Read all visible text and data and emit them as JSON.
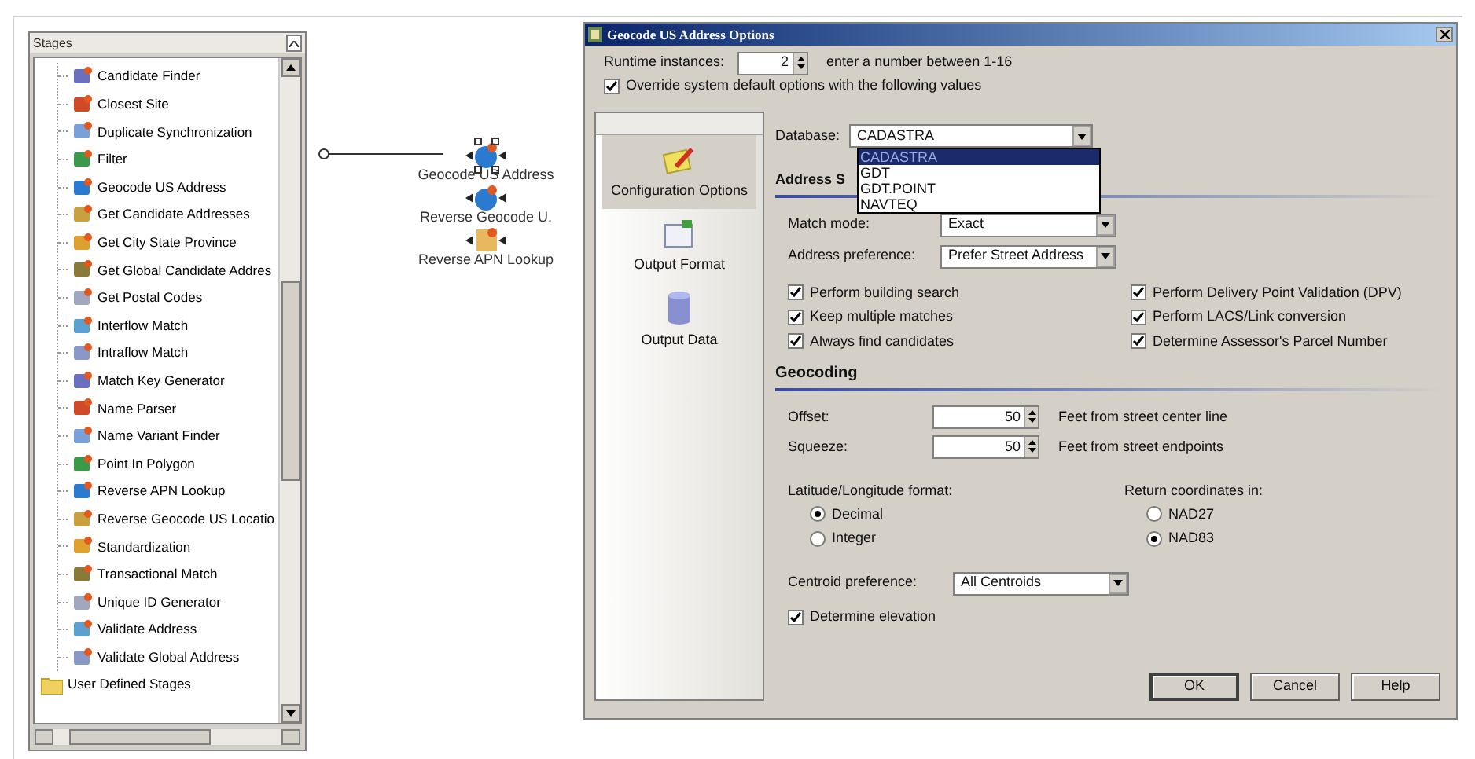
{
  "stages_panel": {
    "title": "Stages",
    "items": [
      {
        "label": "Candidate Finder"
      },
      {
        "label": "Closest Site"
      },
      {
        "label": "Duplicate Synchronization"
      },
      {
        "label": "Filter"
      },
      {
        "label": "Geocode US Address"
      },
      {
        "label": "Get Candidate Addresses"
      },
      {
        "label": "Get City State Province"
      },
      {
        "label": "Get Global Candidate Addres"
      },
      {
        "label": "Get Postal Codes"
      },
      {
        "label": "Interflow Match"
      },
      {
        "label": "Intraflow Match"
      },
      {
        "label": "Match Key Generator"
      },
      {
        "label": "Name Parser"
      },
      {
        "label": "Name Variant Finder"
      },
      {
        "label": "Point In Polygon"
      },
      {
        "label": "Reverse APN Lookup"
      },
      {
        "label": "Reverse Geocode US Locatio"
      },
      {
        "label": "Standardization"
      },
      {
        "label": "Transactional Match"
      },
      {
        "label": "Unique ID Generator"
      },
      {
        "label": "Validate Address"
      },
      {
        "label": "Validate Global Address"
      }
    ],
    "folder": "User Defined Stages"
  },
  "canvas": {
    "nodes": [
      {
        "label": "Geocode US Address",
        "selected": true
      },
      {
        "label": "Reverse  Geocode  U.",
        "selected": false
      },
      {
        "label": "Reverse APN Lookup",
        "selected": false
      }
    ]
  },
  "dialog": {
    "title": "Geocode US Address Options",
    "runtime_label": "Runtime instances:",
    "runtime_value": "2",
    "runtime_hint": "enter a number between 1-16",
    "override": {
      "label": "Override system default options with the following values",
      "checked": true
    },
    "nav": [
      {
        "label": "Configuration Options",
        "selected": true
      },
      {
        "label": "Output Format",
        "selected": false
      },
      {
        "label": "Output Data",
        "selected": false
      }
    ],
    "database": {
      "label": "Database:",
      "value": "CADASTRA",
      "expanded": true,
      "options": [
        {
          "label": "CADASTRA",
          "selected": true
        },
        {
          "label": "GDT",
          "selected": false
        },
        {
          "label": "GDT.POINT",
          "selected": false
        },
        {
          "label": "NAVTEQ",
          "selected": false
        }
      ]
    },
    "address_heading": "Address S",
    "match_mode": {
      "label": "Match mode:",
      "value": "Exact"
    },
    "address_preference": {
      "label": "Address preference:",
      "value": "Prefer Street Address"
    },
    "options_left": [
      {
        "label": "Perform building search",
        "checked": true
      },
      {
        "label": "Keep multiple matches",
        "checked": true
      },
      {
        "label": "Always find candidates",
        "checked": true
      }
    ],
    "options_right": [
      {
        "label": "Perform Delivery Point Validation (DPV)",
        "checked": true
      },
      {
        "label": "Perform LACS/Link conversion",
        "checked": true
      },
      {
        "label": "Determine Assessor's Parcel Number",
        "checked": true
      }
    ],
    "geocoding_heading": "Geocoding",
    "offset": {
      "label": "Offset:",
      "value": "50",
      "unit": "Feet from street center line"
    },
    "squeeze": {
      "label": "Squeeze:",
      "value": "50",
      "unit": "Feet from street endpoints"
    },
    "latlong_format": {
      "label": "Latitude/Longitude format:",
      "options": [
        {
          "label": "Decimal",
          "selected": true
        },
        {
          "label": "Integer",
          "selected": false
        }
      ]
    },
    "return_coordinates": {
      "label": "Return coordinates in:",
      "options": [
        {
          "label": "NAD27",
          "selected": false
        },
        {
          "label": "NAD83",
          "selected": true
        }
      ]
    },
    "centroid": {
      "label": "Centroid preference:",
      "value": "All Centroids"
    },
    "elevation": {
      "label": "Determine elevation",
      "checked": true
    },
    "buttons": [
      "OK",
      "Cancel",
      "Help"
    ]
  }
}
